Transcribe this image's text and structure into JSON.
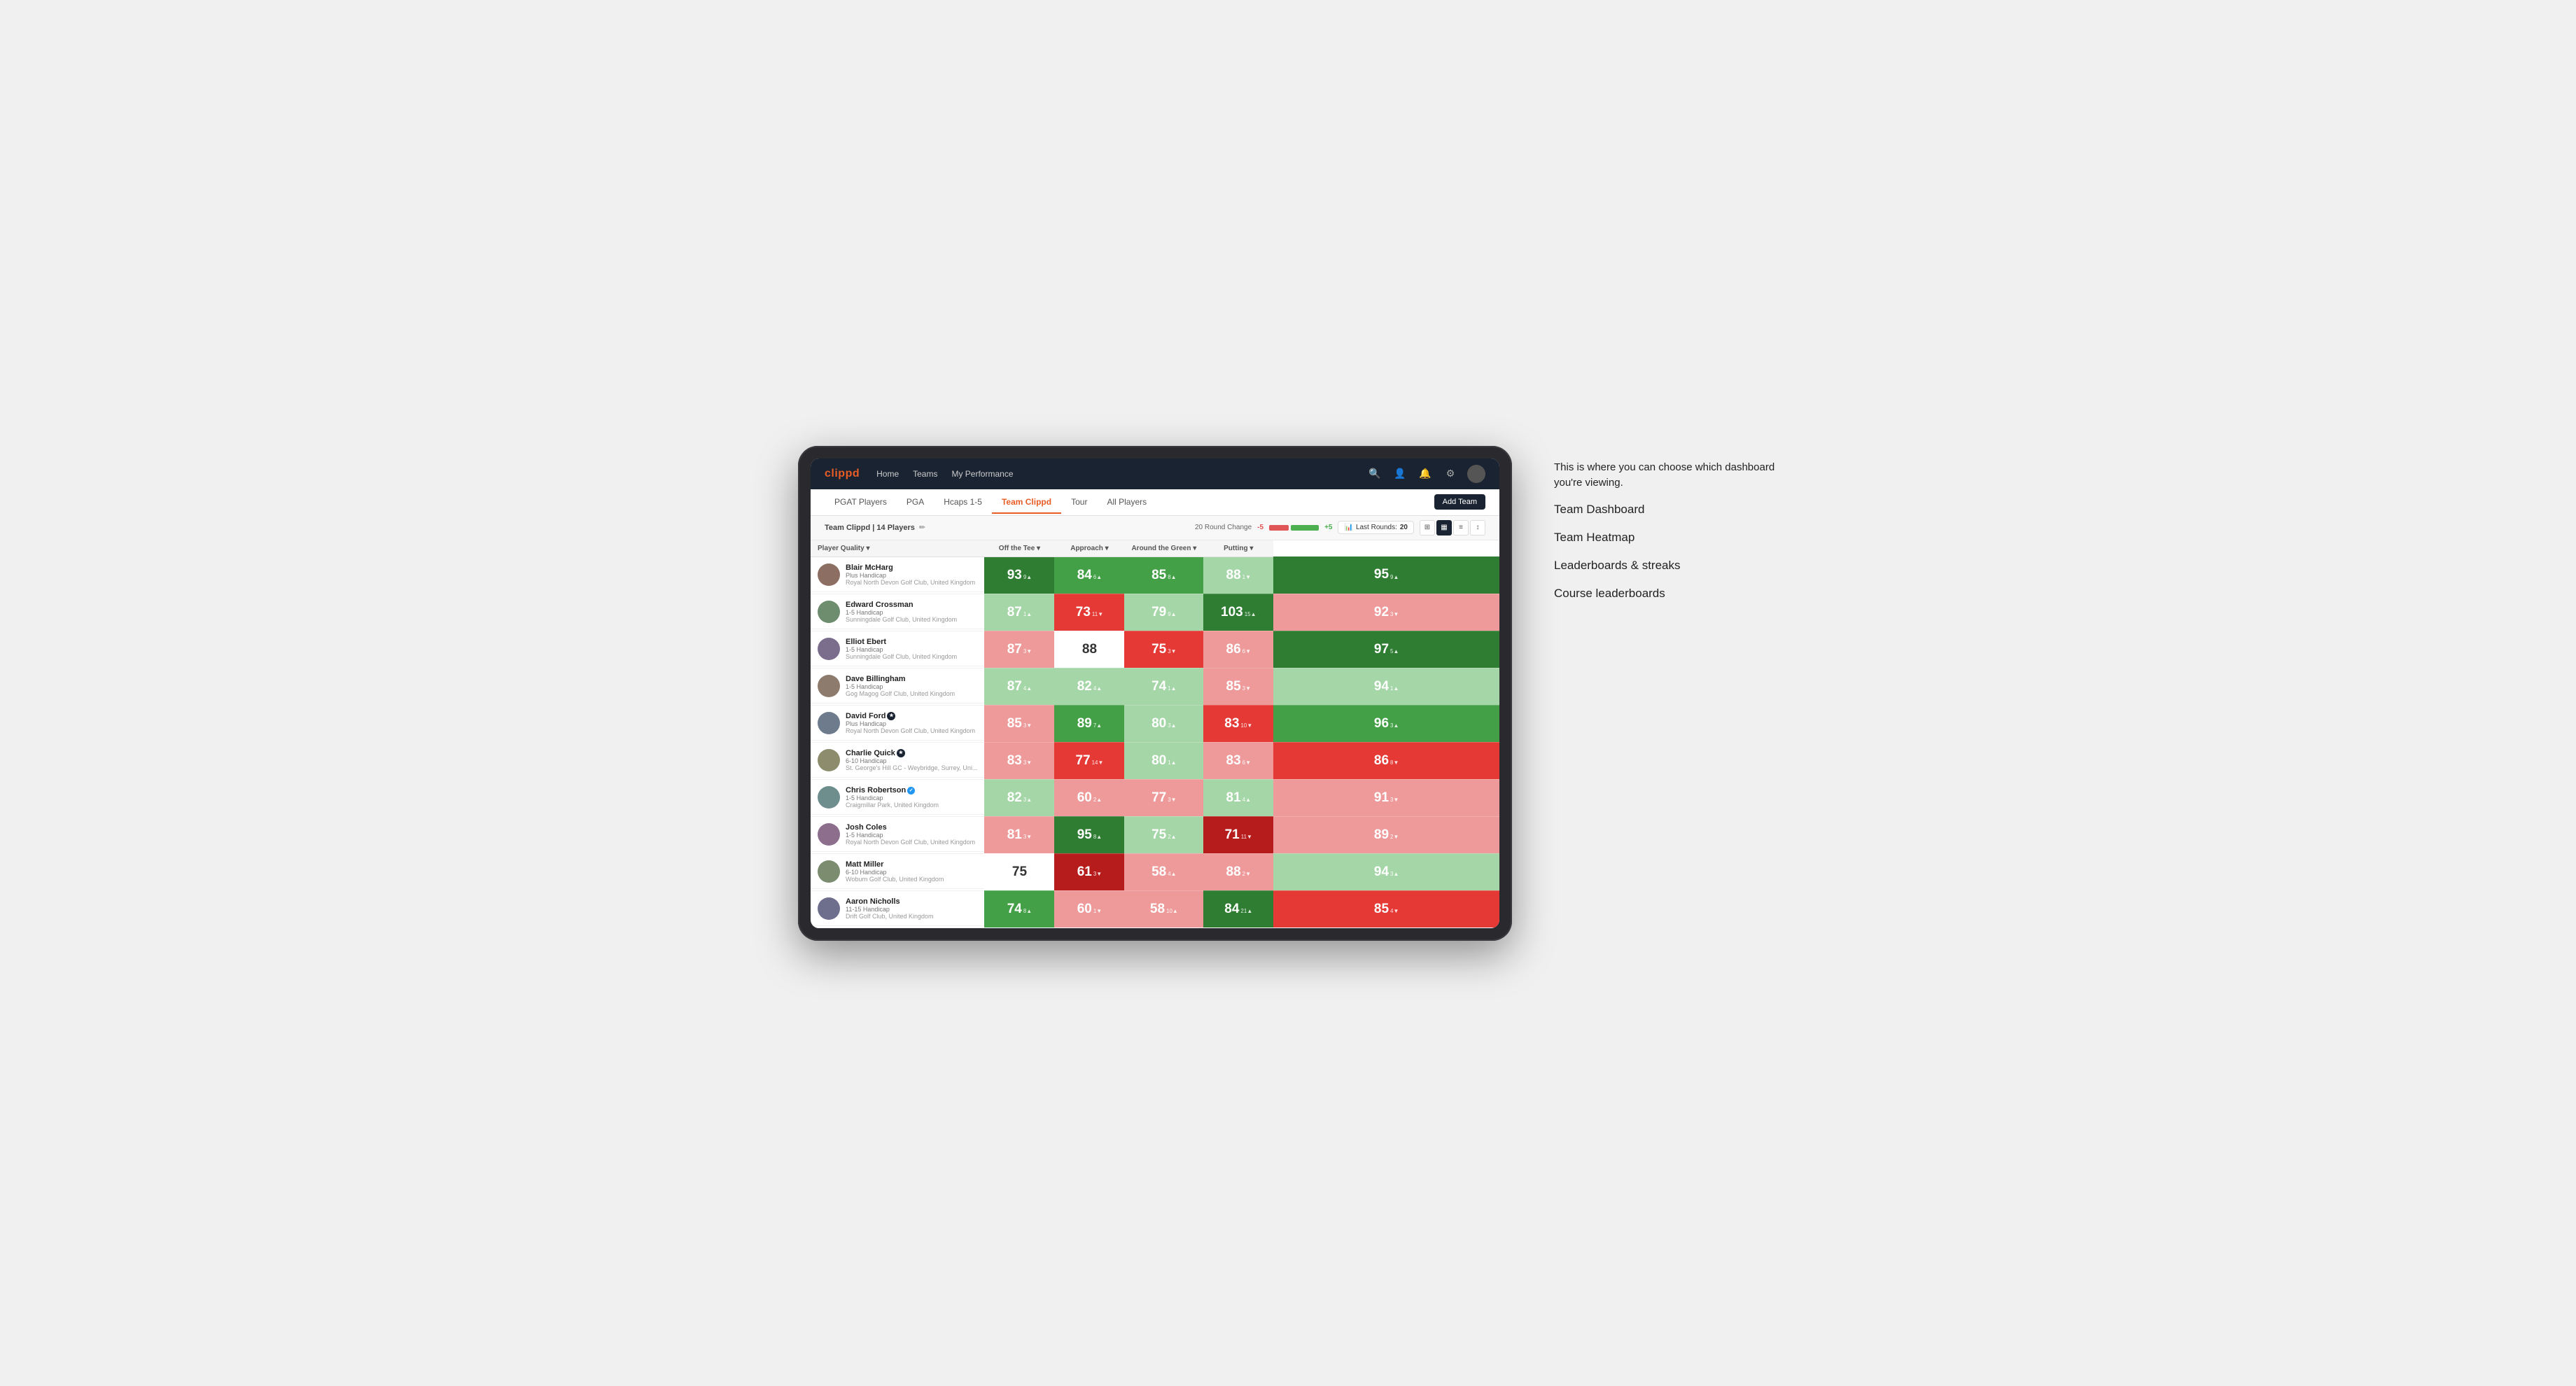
{
  "annotation": {
    "intro_text": "This is where you can choose which dashboard you're viewing.",
    "items": [
      "Team Dashboard",
      "Team Heatmap",
      "Leaderboards & streaks",
      "Course leaderboards"
    ]
  },
  "navbar": {
    "logo": "clippd",
    "links": [
      "Home",
      "Teams",
      "My Performance"
    ],
    "search_label": "search",
    "user_label": "user",
    "notifications_label": "notifications",
    "settings_label": "settings"
  },
  "subnav": {
    "tabs": [
      "PGAT Players",
      "PGA",
      "Hcaps 1-5",
      "Team Clippd",
      "Tour",
      "All Players"
    ],
    "active_tab": "Team Clippd",
    "add_team_label": "Add Team"
  },
  "team_header": {
    "team_name": "Team Clippd",
    "player_count": "14 Players",
    "round_change_label": "20 Round Change",
    "change_negative": "-5",
    "change_positive": "+5",
    "last_rounds_label": "Last Rounds:",
    "last_rounds_value": "20",
    "view_options": [
      "grid",
      "heatmap",
      "chart",
      "expand"
    ]
  },
  "table": {
    "columns": [
      "Player Quality ▾",
      "Off the Tee ▾",
      "Approach ▾",
      "Around the Green ▾",
      "Putting ▾"
    ],
    "rows": [
      {
        "name": "Blair McHarg",
        "handicap": "Plus Handicap",
        "club": "Royal North Devon Golf Club, United Kingdom",
        "stats": [
          {
            "value": "93",
            "change": "9▲",
            "bg": "dark-green"
          },
          {
            "value": "84",
            "change": "6▲",
            "bg": "med-green"
          },
          {
            "value": "85",
            "change": "8▲",
            "bg": "med-green"
          },
          {
            "value": "88",
            "change": "1▼",
            "bg": "light-green"
          },
          {
            "value": "95",
            "change": "9▲",
            "bg": "dark-green"
          }
        ]
      },
      {
        "name": "Edward Crossman",
        "handicap": "1-5 Handicap",
        "club": "Sunningdale Golf Club, United Kingdom",
        "stats": [
          {
            "value": "87",
            "change": "1▲",
            "bg": "light-green"
          },
          {
            "value": "73",
            "change": "11▼",
            "bg": "med-red"
          },
          {
            "value": "79",
            "change": "9▲",
            "bg": "light-green"
          },
          {
            "value": "103",
            "change": "15▲",
            "bg": "dark-green"
          },
          {
            "value": "92",
            "change": "3▼",
            "bg": "light-red"
          }
        ]
      },
      {
        "name": "Elliot Ebert",
        "handicap": "1-5 Handicap",
        "club": "Sunningdale Golf Club, United Kingdom",
        "stats": [
          {
            "value": "87",
            "change": "3▼",
            "bg": "light-red"
          },
          {
            "value": "88",
            "change": "",
            "bg": "white"
          },
          {
            "value": "75",
            "change": "3▼",
            "bg": "med-red"
          },
          {
            "value": "86",
            "change": "6▼",
            "bg": "light-red"
          },
          {
            "value": "97",
            "change": "5▲",
            "bg": "dark-green"
          }
        ]
      },
      {
        "name": "Dave Billingham",
        "handicap": "1-5 Handicap",
        "club": "Gog Magog Golf Club, United Kingdom",
        "stats": [
          {
            "value": "87",
            "change": "4▲",
            "bg": "light-green"
          },
          {
            "value": "82",
            "change": "4▲",
            "bg": "light-green"
          },
          {
            "value": "74",
            "change": "1▲",
            "bg": "light-green"
          },
          {
            "value": "85",
            "change": "3▼",
            "bg": "light-red"
          },
          {
            "value": "94",
            "change": "1▲",
            "bg": "light-green"
          }
        ]
      },
      {
        "name": "David Ford",
        "handicap": "Plus Handicap",
        "club": "Royal North Devon Golf Club, United Kingdom",
        "badge": true,
        "stats": [
          {
            "value": "85",
            "change": "3▼",
            "bg": "light-red"
          },
          {
            "value": "89",
            "change": "7▲",
            "bg": "med-green"
          },
          {
            "value": "80",
            "change": "3▲",
            "bg": "light-green"
          },
          {
            "value": "83",
            "change": "10▼",
            "bg": "med-red"
          },
          {
            "value": "96",
            "change": "3▲",
            "bg": "med-green"
          }
        ]
      },
      {
        "name": "Charlie Quick",
        "handicap": "6-10 Handicap",
        "club": "St. George's Hill GC - Weybridge, Surrey, Uni...",
        "badge": true,
        "stats": [
          {
            "value": "83",
            "change": "3▼",
            "bg": "light-red"
          },
          {
            "value": "77",
            "change": "14▼",
            "bg": "med-red"
          },
          {
            "value": "80",
            "change": "1▲",
            "bg": "light-green"
          },
          {
            "value": "83",
            "change": "6▼",
            "bg": "light-red"
          },
          {
            "value": "86",
            "change": "8▼",
            "bg": "med-red"
          }
        ]
      },
      {
        "name": "Chris Robertson",
        "handicap": "1-5 Handicap",
        "club": "Craigmillar Park, United Kingdom",
        "verified": true,
        "stats": [
          {
            "value": "82",
            "change": "3▲",
            "bg": "light-green"
          },
          {
            "value": "60",
            "change": "2▲",
            "bg": "light-red"
          },
          {
            "value": "77",
            "change": "3▼",
            "bg": "light-red"
          },
          {
            "value": "81",
            "change": "4▲",
            "bg": "light-green"
          },
          {
            "value": "91",
            "change": "3▼",
            "bg": "light-red"
          }
        ]
      },
      {
        "name": "Josh Coles",
        "handicap": "1-5 Handicap",
        "club": "Royal North Devon Golf Club, United Kingdom",
        "stats": [
          {
            "value": "81",
            "change": "3▼",
            "bg": "light-red"
          },
          {
            "value": "95",
            "change": "8▲",
            "bg": "dark-green"
          },
          {
            "value": "75",
            "change": "2▲",
            "bg": "light-green"
          },
          {
            "value": "71",
            "change": "11▼",
            "bg": "dark-red"
          },
          {
            "value": "89",
            "change": "2▼",
            "bg": "light-red"
          }
        ]
      },
      {
        "name": "Matt Miller",
        "handicap": "6-10 Handicap",
        "club": "Woburn Golf Club, United Kingdom",
        "stats": [
          {
            "value": "75",
            "change": "",
            "bg": "white"
          },
          {
            "value": "61",
            "change": "3▼",
            "bg": "dark-red"
          },
          {
            "value": "58",
            "change": "4▲",
            "bg": "light-red"
          },
          {
            "value": "88",
            "change": "2▼",
            "bg": "light-red"
          },
          {
            "value": "94",
            "change": "3▲",
            "bg": "light-green"
          }
        ]
      },
      {
        "name": "Aaron Nicholls",
        "handicap": "11-15 Handicap",
        "club": "Drift Golf Club, United Kingdom",
        "stats": [
          {
            "value": "74",
            "change": "8▲",
            "bg": "med-green"
          },
          {
            "value": "60",
            "change": "1▼",
            "bg": "light-red"
          },
          {
            "value": "58",
            "change": "10▲",
            "bg": "light-red"
          },
          {
            "value": "84",
            "change": "21▲",
            "bg": "dark-green"
          },
          {
            "value": "85",
            "change": "4▼",
            "bg": "med-red"
          }
        ]
      }
    ]
  },
  "colors": {
    "dark-green": "#2e7d32",
    "med-green": "#43a047",
    "light-green": "#a5d6a7",
    "white": "#ffffff",
    "light-red": "#ef9a9a",
    "med-red": "#e53935",
    "dark-red": "#b71c1c",
    "accent": "#e85d26",
    "navbar_bg": "#1a2332"
  }
}
